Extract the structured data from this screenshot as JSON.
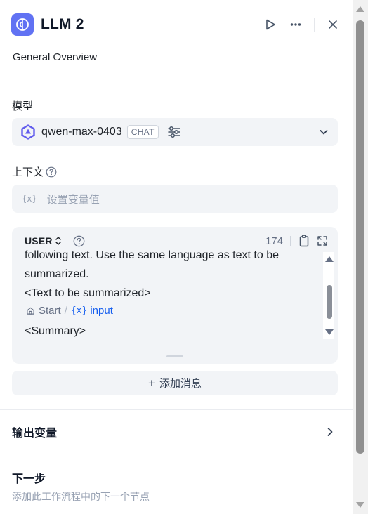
{
  "header": {
    "title": "LLM 2",
    "description": "General Overview",
    "icons": [
      "llm-node-icon",
      "play-icon",
      "more-icon",
      "close-icon"
    ]
  },
  "model_section": {
    "label": "模型",
    "model_name": "qwen-max-0403",
    "badge": "CHAT"
  },
  "context_section": {
    "label": "上下文",
    "placeholder": "设置变量值",
    "glyph": "{x}"
  },
  "prompt_editor": {
    "role": "USER",
    "count": "174",
    "lines": [
      "following text. Use the same language as text to be",
      "summarized.",
      "<Text to be summarized>",
      "<Summary>"
    ],
    "variable": {
      "node": "Start",
      "separator": "/",
      "glyph": "{x}",
      "name": "input"
    }
  },
  "add_message": {
    "label": "添加消息"
  },
  "output": {
    "label": "输出变量"
  },
  "next_step": {
    "title": "下一步",
    "description": "添加此工作流程中的下一个节点"
  },
  "colors": {
    "accent": "#6172f3",
    "variable_blue": "#155eef",
    "field_bg": "#f2f4f7"
  }
}
